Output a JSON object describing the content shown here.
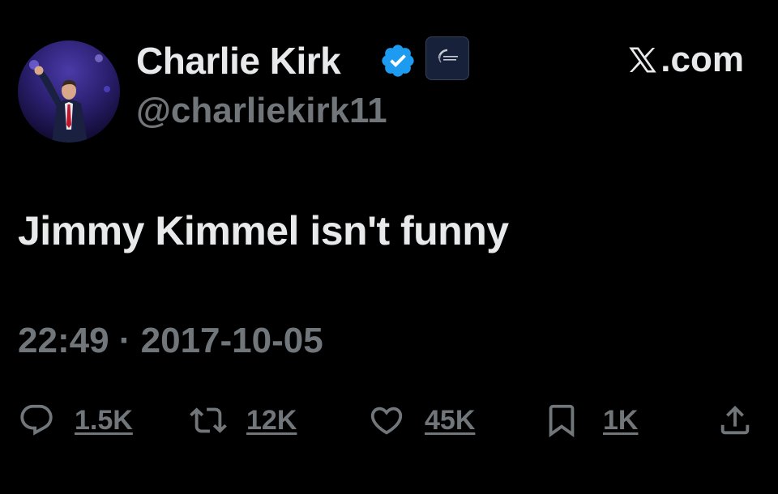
{
  "author": {
    "display_name": "Charlie Kirk",
    "handle": "@charliekirk11",
    "avatar_icon": "person-avatar",
    "verified_icon": "verified-badge-icon",
    "affiliate_badge_icon": "organization-logo-icon"
  },
  "brand": {
    "label": ".com",
    "logo_icon": "x-logo-icon"
  },
  "tweet": {
    "text": "Jimmy Kimmel isn't funny",
    "timestamp": "22:49 · 2017-10-05"
  },
  "actions": {
    "reply": {
      "icon": "reply-icon",
      "count": "1.5K"
    },
    "repost": {
      "icon": "repost-icon",
      "count": "12K"
    },
    "like": {
      "icon": "heart-icon",
      "count": "45K"
    },
    "bookmark": {
      "icon": "bookmark-icon",
      "count": "1K"
    },
    "share": {
      "icon": "share-icon"
    }
  },
  "colors": {
    "background": "#000000",
    "primary_text": "#e7e9ea",
    "secondary_text": "#71767b",
    "verified_blue": "#1d9bf0"
  }
}
